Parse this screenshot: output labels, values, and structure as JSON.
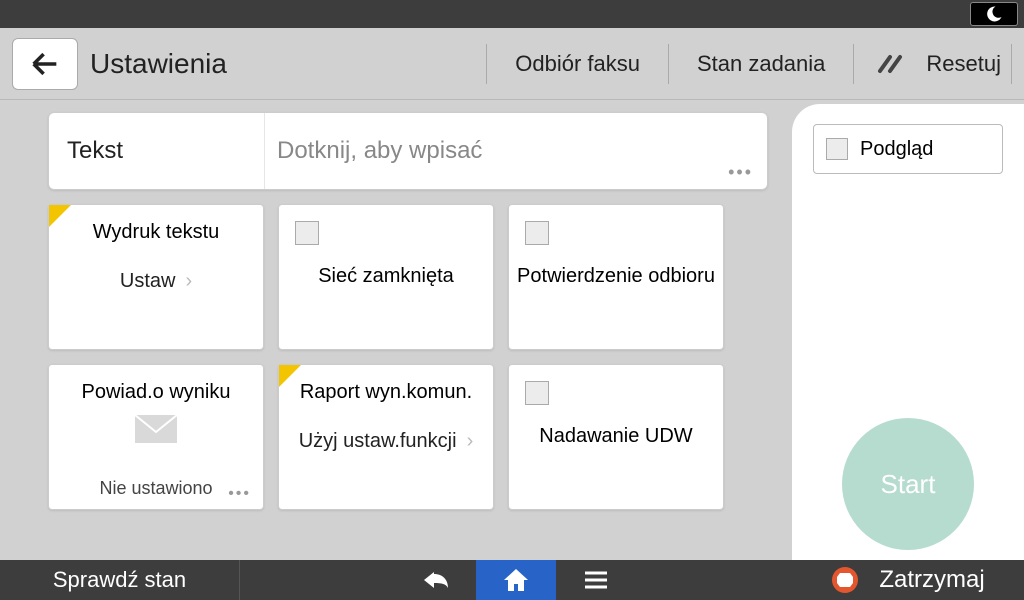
{
  "header": {
    "title": "Ustawienia",
    "fax_receive": "Odbiór faksu",
    "job_status": "Stan zadania",
    "reset": "Resetuj"
  },
  "text_row": {
    "label": "Tekst",
    "placeholder": "Dotknij, aby wpisać"
  },
  "row1": {
    "tile1": {
      "title": "Wydruk tekstu",
      "sub": "Ustaw"
    },
    "tile2": {
      "center": "Sieć zamknięta"
    },
    "tile3": {
      "center": "Potwierdzenie odbioru"
    }
  },
  "row2": {
    "tile1": {
      "title": "Powiad.o wyniku",
      "bottom": "Nie ustawiono"
    },
    "tile2": {
      "title": "Raport wyn.komun.",
      "sub": "Użyj ustaw.funkcji"
    },
    "tile3": {
      "center": "Nadawanie UDW"
    }
  },
  "right": {
    "preview": "Podgląd",
    "start": "Start"
  },
  "bottom": {
    "check_status": "Sprawdź stan",
    "stop": "Zatrzymaj"
  }
}
